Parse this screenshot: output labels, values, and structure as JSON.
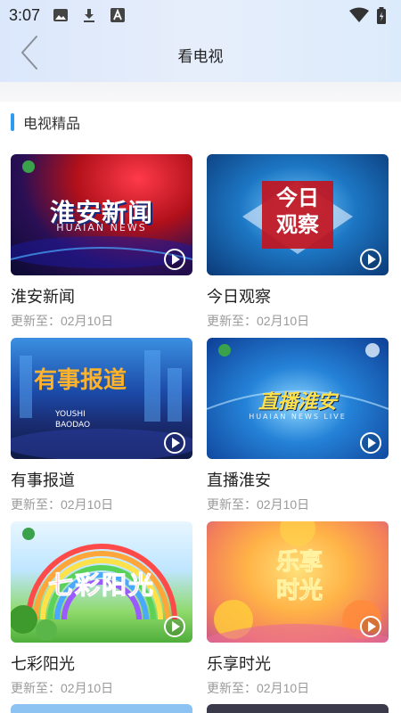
{
  "status_bar": {
    "time": "3:07",
    "icons": [
      "image-icon",
      "download-icon",
      "font-icon"
    ],
    "right_icons": [
      "wifi-icon",
      "battery-icon"
    ]
  },
  "header": {
    "back_icon": "chevron-left-icon",
    "title": "看电视"
  },
  "section": {
    "title": "电视精品",
    "accent_color": "#2c9bf0"
  },
  "programs": [
    {
      "name": "淮安新闻",
      "update": "更新至：02月10日",
      "thumb_text": "淮安新闻",
      "thumb_sub": "HUAIAN NEWS"
    },
    {
      "name": "今日观察",
      "update": "更新至：02月10日",
      "thumb_text": "今日观察",
      "thumb_sub": ""
    },
    {
      "name": "有事报道",
      "update": "更新至：02月10日",
      "thumb_text": "有事报道",
      "thumb_sub": "YOUSHI BAODAO"
    },
    {
      "name": "直播淮安",
      "update": "更新至：02月10日",
      "thumb_text": "直播淮安",
      "thumb_sub": "HUAIAN NEWS LIVE"
    },
    {
      "name": "七彩阳光",
      "update": "更新至：02月10日",
      "thumb_text": "七彩阳光",
      "thumb_sub": ""
    },
    {
      "name": "乐享时光",
      "update": "更新至：02月10日",
      "thumb_text": "乐享时光",
      "thumb_sub": ""
    }
  ],
  "colors": {
    "header_gradient_start": "#dbe7fb",
    "text_primary": "#222222",
    "text_secondary": "#9a9a9a"
  }
}
